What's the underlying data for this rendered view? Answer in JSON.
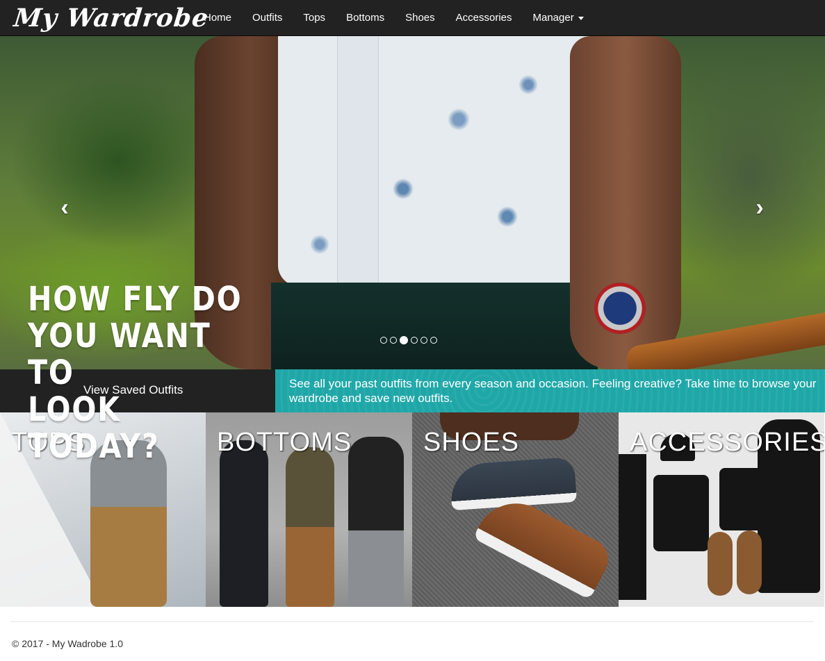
{
  "brand": "My Wardrobe",
  "nav": {
    "items": [
      "Home",
      "Outfits",
      "Tops",
      "Bottoms",
      "Shoes",
      "Accessories"
    ],
    "manager_label": "Manager"
  },
  "hero": {
    "headline": [
      "HOW FLY DO",
      "YOU WANT TO",
      "LOOK TODAY?"
    ],
    "prev_icon": "‹",
    "next_icon": "›",
    "slide_count": 6,
    "active_slide": 3
  },
  "band": {
    "saved_link": "View Saved Outfits",
    "description": "See all your past outfits from every season and occasion. Feeling creative? Take time to browse your wardrobe and save new outfits.",
    "accent_color": "#1fa7a8"
  },
  "tiles": [
    {
      "label": "TOPS"
    },
    {
      "label": "BOTTOMS"
    },
    {
      "label": "SHOES"
    },
    {
      "label": "ACCESSORIES"
    }
  ],
  "footer": {
    "copyright": "© 2017 - My Wadrobe 1.0"
  }
}
